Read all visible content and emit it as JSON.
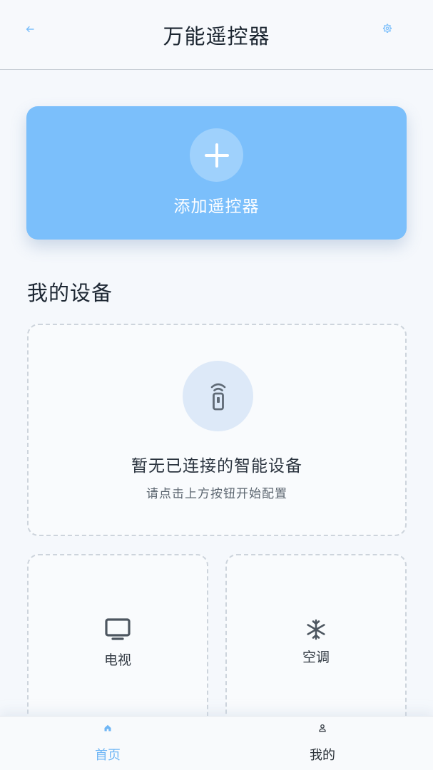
{
  "header": {
    "title": "万能遥控器",
    "back_icon": "arrow-left-icon",
    "settings_icon": "gear-icon"
  },
  "add_card": {
    "label": "添加遥控器",
    "icon": "plus-icon"
  },
  "section": {
    "title": "我的设备"
  },
  "empty_state": {
    "icon": "remote-control-icon",
    "message": "暂无已连接的智能设备",
    "hint": "请点击上方按钮开始配置"
  },
  "devices": [
    {
      "label": "电视",
      "icon": "tv-icon"
    },
    {
      "label": "空调",
      "icon": "snowflake-icon"
    }
  ],
  "bottom_nav": {
    "items": [
      {
        "label": "首页",
        "icon": "home-icon",
        "active": true
      },
      {
        "label": "我的",
        "icon": "user-icon",
        "active": false
      }
    ]
  },
  "colors": {
    "accent": "#7bbffb",
    "active_nav": "#6fb6f5",
    "background": "#f5f8fc"
  }
}
